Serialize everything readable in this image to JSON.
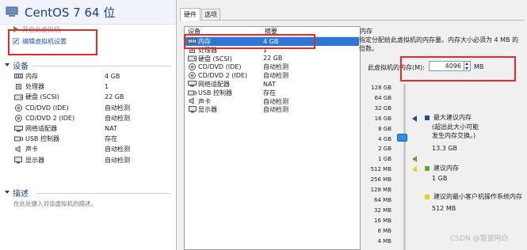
{
  "left_panel": {
    "title": "CentOS 7 64 位",
    "actions": [
      {
        "label": "开启此虚拟机",
        "icon": "play-icon"
      },
      {
        "label": "编辑虚拟机设置",
        "icon": "edit-settings-icon"
      }
    ],
    "devices_header": "设备",
    "devices": [
      {
        "name": "内存",
        "value": "4 GB",
        "icon": "memory-icon"
      },
      {
        "name": "处理器",
        "value": "1",
        "icon": "cpu-icon"
      },
      {
        "name": "硬盘 (SCSI)",
        "value": "22 GB",
        "icon": "hard-disk-icon"
      },
      {
        "name": "CD/DVD (IDE)",
        "value": "自动检测",
        "icon": "cd-icon"
      },
      {
        "name": "CD/DVD 2 (IDE)",
        "value": "自动检测",
        "icon": "cd-icon"
      },
      {
        "name": "网络适配器",
        "value": "NAT",
        "icon": "network-icon"
      },
      {
        "name": "USB 控制器",
        "value": "存在",
        "icon": "usb-icon"
      },
      {
        "name": "声卡",
        "value": "自动检测",
        "icon": "speaker-icon"
      },
      {
        "name": "显示器",
        "value": "自动检测",
        "icon": "monitor-icon"
      }
    ],
    "description_header": "描述",
    "description_placeholder": "在此处键入对该虚拟机的描述。"
  },
  "dialog": {
    "tabs": [
      {
        "label": "硬件",
        "active": true
      },
      {
        "label": "选项",
        "active": false
      }
    ],
    "list_headers": {
      "device": "设备",
      "summary": "摘要"
    },
    "hardware": [
      {
        "name": "内存",
        "value": "4 GB",
        "icon": "memory-icon",
        "selected": true
      },
      {
        "name": "处理器",
        "value": "1",
        "icon": "cpu-icon"
      },
      {
        "name": "硬盘 (SCSI)",
        "value": "22 GB",
        "icon": "hard-disk-icon"
      },
      {
        "name": "CD/DVD (IDE)",
        "value": "自动检测",
        "icon": "cd-icon"
      },
      {
        "name": "CD/DVD 2 (IDE)",
        "value": "自动检测",
        "icon": "cd-icon"
      },
      {
        "name": "网络适配器",
        "value": "NAT",
        "icon": "network-icon"
      },
      {
        "name": "USB 控制器",
        "value": "存在",
        "icon": "usb-icon"
      },
      {
        "name": "声卡",
        "value": "自动检测",
        "icon": "speaker-icon"
      },
      {
        "name": "显示器",
        "value": "自动检测",
        "icon": "monitor-icon"
      }
    ],
    "memory": {
      "group_label": "内存",
      "description": "指定分配给此虚拟机的内存量。内存大小必须为 4 MB 的倍数。",
      "field_label": "此虚拟机的内存(M):",
      "value": "4096",
      "unit": "MB",
      "scale_ticks": [
        "128 GB",
        "64 GB",
        "32 GB",
        "16 GB",
        "8 GB",
        "4 GB",
        "2 GB",
        "1 GB",
        "512 MB",
        "256 MB",
        "128 MB",
        "64 MB",
        "32 MB",
        "16 MB",
        "8 MB",
        "4 MB"
      ],
      "selected_tick": "4 GB",
      "legend": {
        "max_recommended": {
          "label": "最大建议内存",
          "note": "(超出此大小可能\n发生内存交换。)",
          "value": "13.3 GB",
          "color": "#1f4f91"
        },
        "recommended": {
          "label": "建议内存",
          "value": "1 GB",
          "color": "#5aa830"
        },
        "guest_min": {
          "label": "建议的最小客户机操作系统内存",
          "value": "512 MB",
          "color": "#f2cc1a"
        }
      }
    }
  },
  "watermark": "CSDN @富婆阿白",
  "colors": {
    "annotation_red": "#e52a2a",
    "selection_blue": "#2f76d9",
    "title_blue": "#1d3f8c"
  }
}
